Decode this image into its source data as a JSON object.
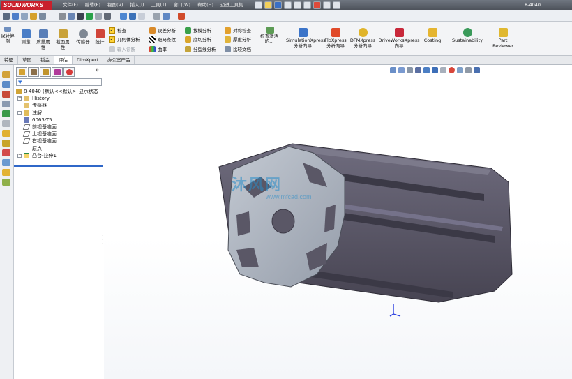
{
  "app": {
    "logo_text": "SOLIDWORKS",
    "document_title": "8-4040"
  },
  "menus": [
    "文件(F)",
    "编辑(E)",
    "视图(V)",
    "插入(I)",
    "工具(T)",
    "窗口(W)",
    "帮助(H)",
    "迈进工具集"
  ],
  "command_manager": {
    "design_study": "设计算例",
    "measure": "测量",
    "mass_properties": "质量属性",
    "section_properties": "截面属性",
    "sensor": "传感器",
    "statistics": "统计",
    "check": "检查",
    "geometry_analysis": "几何体分析",
    "import_diagnostics": "输入诊断",
    "deviation_analysis": "误差分析",
    "zebra_stripes": "斑马条纹",
    "curvature": "曲率",
    "draft_analysis": "拔模分析",
    "undercut_analysis": "底切分析",
    "parting_line_analysis": "分型线分析",
    "symmetry_check": "对称检查",
    "thickness_analysis": "厚度分析",
    "compare_documents": "比较文档",
    "check_active_doc": "检查激活的...",
    "simulationxpress": "SimulationXpress 分析向导",
    "floxpress": "FloXpress 分析向导",
    "dfmxpress": "DFMXpress 分析向导",
    "driveworksxpress": "DriveWorksXpress 向导",
    "costing": "Costing",
    "sustainability": "Sustainability",
    "part_reviewer": "Part Reviewer"
  },
  "tabs": [
    "特征",
    "草图",
    "钣金",
    "评估",
    "DimXpert",
    "办公室产品"
  ],
  "active_tab": "评估",
  "feature_tree": {
    "root": "8-4040 (默认<<默认>_显示状态",
    "items": [
      "History",
      "传感器",
      "注解",
      "6063-T5",
      "前视基准面",
      "上视基准面",
      "右视基准面",
      "原点",
      "凸台-拉伸1"
    ]
  },
  "watermark": {
    "text": "沐风网",
    "url": "www.mfcad.com"
  },
  "colors": {
    "title_bar": "#5a6068",
    "logo": "#c9202c",
    "model": "#5b5868",
    "model_face": "#a9b0bb",
    "rollback_bar": "#2f67c8"
  }
}
